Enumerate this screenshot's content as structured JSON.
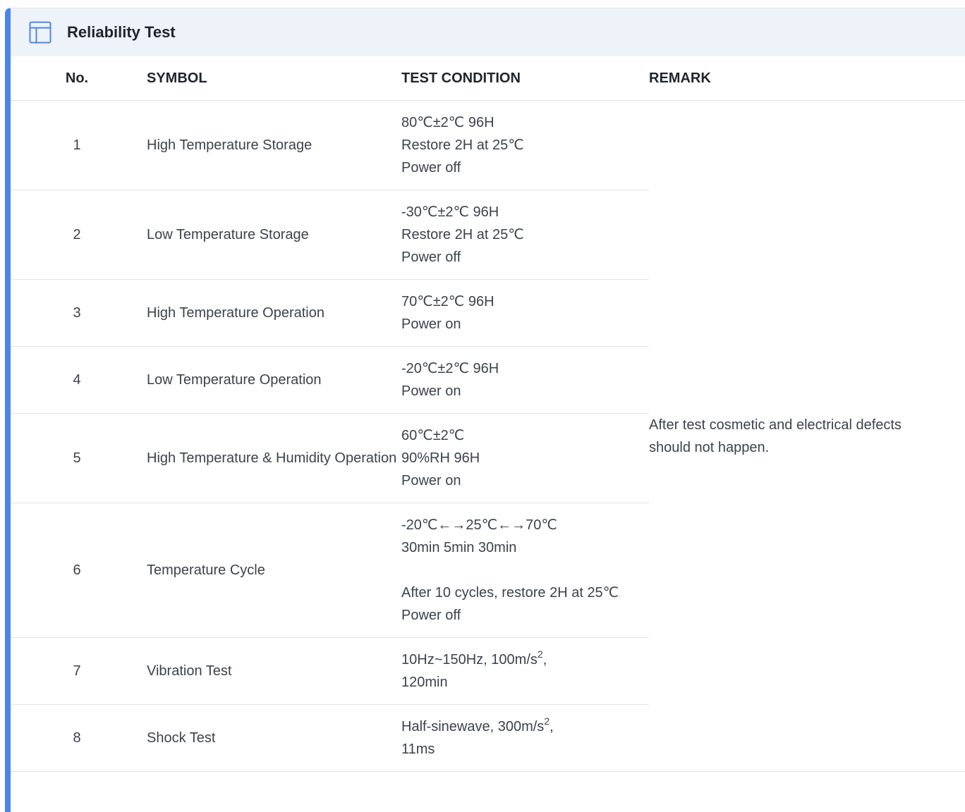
{
  "header": {
    "title": "Reliability Test",
    "icon": "table-layout-icon",
    "accent_color": "#4a86e8"
  },
  "columns": {
    "no": "No.",
    "symbol": "SYMBOL",
    "condition": "TEST CONDITION",
    "remark": "REMARK"
  },
  "rows": [
    {
      "no": "1",
      "symbol": "High Temperature Storage",
      "condition": [
        "80℃±2℃ 96H",
        "Restore 2H at 25℃",
        "Power off"
      ]
    },
    {
      "no": "2",
      "symbol": "Low Temperature Storage",
      "condition": [
        "-30℃±2℃ 96H",
        "Restore 2H at 25℃",
        "Power off"
      ]
    },
    {
      "no": "3",
      "symbol": "High Temperature Operation",
      "condition": [
        "70℃±2℃ 96H",
        "Power on"
      ]
    },
    {
      "no": "4",
      "symbol": "Low Temperature Operation",
      "condition": [
        "-20℃±2℃ 96H",
        "Power on"
      ]
    },
    {
      "no": "5",
      "symbol": "High Temperature & Humidity Operation",
      "condition": [
        "60℃±2℃",
        "90%RH 96H",
        "Power on"
      ]
    },
    {
      "no": "6",
      "symbol": "Temperature Cycle",
      "condition": [
        "-20℃←→25℃←→70℃",
        "30min 5min 30min",
        "After 10 cycles, restore 2H at 25℃",
        "Power off"
      ]
    },
    {
      "no": "7",
      "symbol": "Vibration Test",
      "condition": {
        "text": "10Hz~150Hz, 100m/s",
        "sup": "2",
        "tail": ",",
        "line2": "120min"
      }
    },
    {
      "no": "8",
      "symbol": "Shock Test",
      "condition": {
        "text": "Half-sinewave, 300m/s",
        "sup": "2",
        "tail": ",",
        "line2": "11ms"
      }
    }
  ],
  "remark": "After test cosmetic and electrical defects should not happen."
}
